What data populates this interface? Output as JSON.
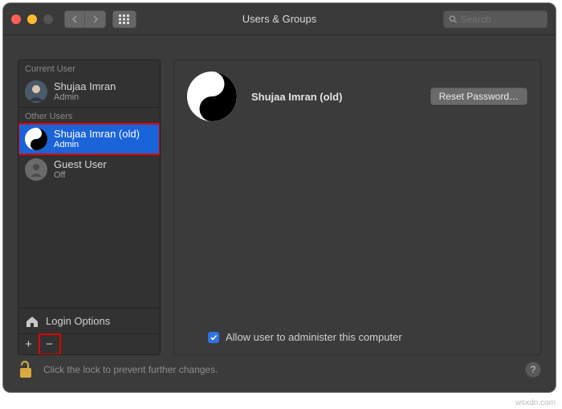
{
  "window": {
    "title": "Users & Groups"
  },
  "search": {
    "placeholder": "Search"
  },
  "sidebar": {
    "current_header": "Current User",
    "other_header": "Other Users",
    "current_user": {
      "name": "Shujaa Imran",
      "role": "Admin"
    },
    "other_users": [
      {
        "name": "Shujaa Imran (old)",
        "role": "Admin"
      },
      {
        "name": "Guest User",
        "role": "Off"
      }
    ],
    "login_options_label": "Login Options"
  },
  "main": {
    "selected_user_name": "Shujaa Imran (old)",
    "reset_password_label": "Reset Password…",
    "admin_checkbox_label": "Allow user to administer this computer"
  },
  "footer": {
    "lock_text": "Click the lock to prevent further changes."
  },
  "watermark": "wsxdn.com"
}
